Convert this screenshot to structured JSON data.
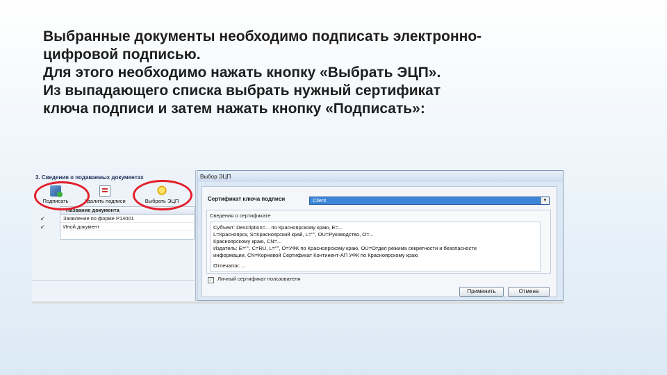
{
  "instructions": [
    "Выбранные документы необходимо подписать электронно-",
    "цифровой подписью.",
    "Для этого необходимо нажать кнопку «Выбрать ЭЦП».",
    "Из выпадающего списка выбрать нужный сертификат",
    "ключа подписи и затем нажать кнопку «Подписать»:"
  ],
  "left_panel": {
    "section_title": "3. Сведения о подаваемых документах",
    "toolbar": {
      "sign_label": "Подписать",
      "delete_label": "Удалить подписи",
      "pick_label": "Выбрать ЭЦП"
    },
    "grid": {
      "header": "Название документа",
      "rows": [
        "Заявление по форме Р14001",
        "Иной документ"
      ]
    },
    "row_marks": [
      "↙",
      "↙"
    ]
  },
  "dialog": {
    "title": "Выбор ЭЦП",
    "cert_label": "Сертификат ключа подписи",
    "cert_value": "Client",
    "info_title": "Сведения о сертификате",
    "subject_lines": [
      "Субъект: Description=... по Красноярскому краю, E=...",
      "L=Красноярск, S=Красноярский край, L=\"\", OU=Руководство, O=...",
      "Красноярскому краю, CN=..."
    ],
    "issuer_lines": [
      "Издатель: E=\"\", C=RU, L=\"\", O=УФК по Красноярскому краю, OU=Отдел режима секретности и безопасности",
      "информации, CN=Корневой Сертификат Континент-АП УФК по Красноярскому краю"
    ],
    "signer_line": "Отпечаток: ...",
    "checkbox_label": "Личный сертификат пользователя",
    "apply_label": "Применить",
    "cancel_label": "Отмена"
  }
}
